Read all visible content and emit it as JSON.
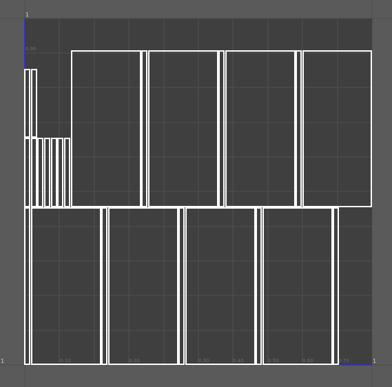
{
  "editor": {
    "title": "",
    "background_color": "#5a5a5a",
    "uv_space_color": "#3f3f3f",
    "grid_color": "#525252",
    "shell_border_color": "#ffffff",
    "u_axis_color": "#2222dd",
    "v_axis_color": "#2222dd",
    "origin_marker_color": "#22cc22"
  },
  "corner_labels": {
    "top_left": "1",
    "bottom_left": "1",
    "bottom_right": "1"
  },
  "grid_labels": {
    "bottom": [
      "0.10",
      "0.20",
      "0.30",
      "0.40",
      "0.50",
      "0.60",
      "0.70",
      "0.80",
      "0.90"
    ],
    "left_top": "0.90"
  },
  "uv_shells": {
    "count": 32
  }
}
